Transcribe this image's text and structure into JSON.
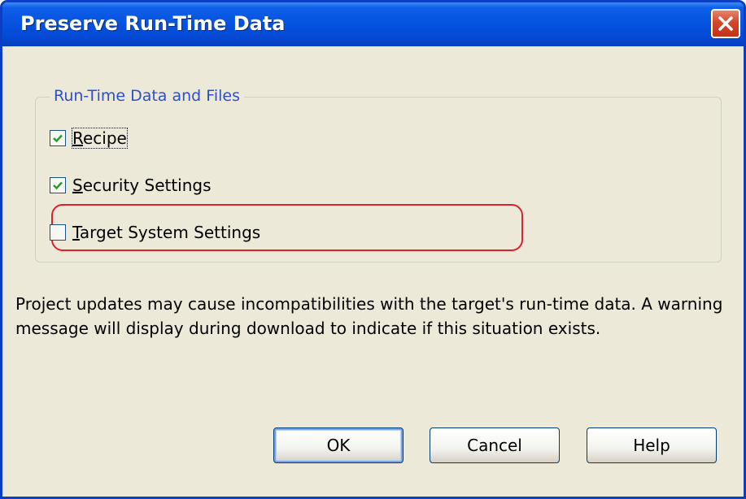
{
  "window": {
    "title": "Preserve Run-Time Data",
    "close_icon": "close-icon"
  },
  "group": {
    "legend": "Run-Time Data and Files",
    "options": [
      {
        "label": "Recipe",
        "mnemonic": "R",
        "checked": true,
        "focused": true
      },
      {
        "label": "Security Settings",
        "mnemonic": "S",
        "checked": true,
        "focused": false
      },
      {
        "label": "Target System Settings",
        "mnemonic": "T",
        "checked": false,
        "focused": false
      }
    ]
  },
  "message": "Project updates may cause incompatibilities with the target's run-time data.  A warning message will display during download to indicate if this situation exists.",
  "buttons": {
    "ok": "OK",
    "cancel": "Cancel",
    "help": "Help"
  },
  "colors": {
    "title_bar": "#0552e0",
    "dialog_bg": "#ece9d8",
    "legend_text": "#2e4fcc",
    "highlight": "#e0202a",
    "close_button": "#d4462a"
  }
}
